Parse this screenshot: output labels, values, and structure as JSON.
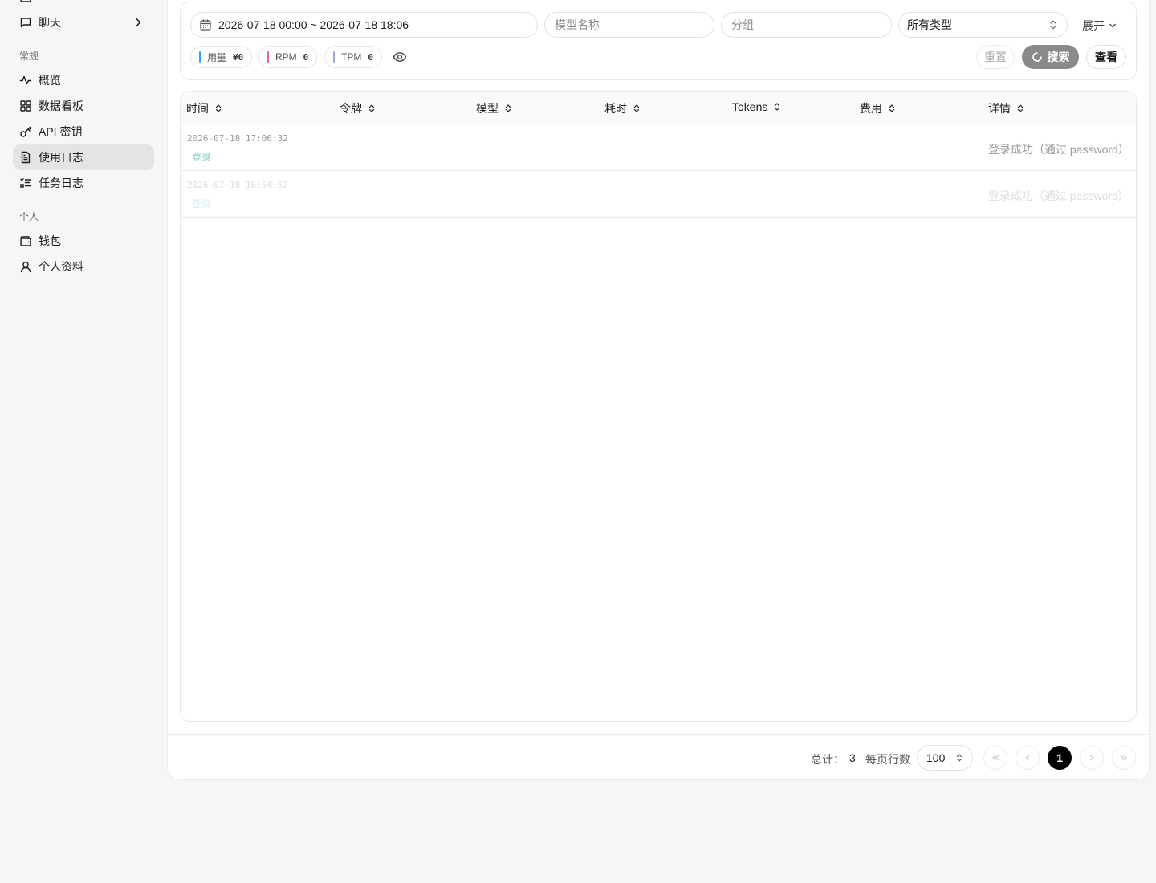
{
  "sidebar": {
    "items_top": [
      {
        "label": "聊天",
        "icon": "chat-icon"
      }
    ],
    "sections": [
      {
        "title": "常规",
        "items": [
          {
            "label": "概览",
            "icon": "activity-icon"
          },
          {
            "label": "数据看板",
            "icon": "dashboard-icon"
          },
          {
            "label": "API 密钥",
            "icon": "key-icon"
          },
          {
            "label": "使用日志",
            "icon": "file-text-icon",
            "active": true
          },
          {
            "label": "任务日志",
            "icon": "list-checks-icon"
          }
        ]
      },
      {
        "title": "个人",
        "items": [
          {
            "label": "钱包",
            "icon": "wallet-icon"
          },
          {
            "label": "个人资料",
            "icon": "user-icon"
          }
        ]
      }
    ]
  },
  "filters": {
    "date_range": "2026-07-18 00:00 ~ 2026-07-18 18:06",
    "model_placeholder": "模型名称",
    "group_placeholder": "分组",
    "type_select": "所有类型",
    "expand_label": "展开"
  },
  "stats": [
    {
      "label": "用量",
      "value": "¥0",
      "color": "#3b9eff"
    },
    {
      "label": "RPM",
      "value": "0",
      "color": "#f06292"
    },
    {
      "label": "TPM",
      "value": "0",
      "color": "#9fa8da"
    }
  ],
  "actions": {
    "reset": "重置",
    "search": "搜索",
    "view": "查看"
  },
  "table": {
    "columns": [
      "时间",
      "令牌",
      "模型",
      "耗时",
      "Tokens",
      "费用",
      "详情"
    ],
    "rows": [
      {
        "time": "2026-07-18 17:06:32",
        "type": "登录",
        "detail": "登录成功（通过 password）"
      },
      {
        "time": "2026-07-18 16:54:52",
        "type": "登录",
        "detail": "登录成功（通过 password）"
      }
    ]
  },
  "pagination": {
    "total_label": "总计：",
    "total": "3",
    "per_page_label": "每页行数",
    "per_page": "100",
    "current_page": "1"
  },
  "colors": {
    "accent_teal": "#7ecfc9",
    "active_nav_bg": "#e4e4e4",
    "search_button": "#8a8a8a"
  }
}
